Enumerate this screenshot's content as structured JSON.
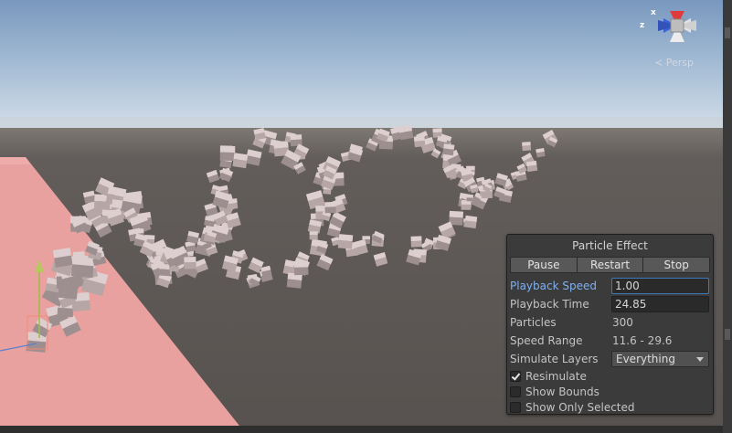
{
  "viewport": {
    "projection_label": "≺ Persp",
    "gizmo_axis_labels": [
      "x",
      "z"
    ]
  },
  "particle_panel": {
    "title": "Particle Effect",
    "buttons": {
      "pause": "Pause",
      "restart": "Restart",
      "stop": "Stop"
    },
    "playback_speed": {
      "label": "Playback Speed",
      "value": "1.00"
    },
    "playback_time": {
      "label": "Playback Time",
      "value": "24.85"
    },
    "particles": {
      "label": "Particles",
      "value": "300"
    },
    "speed_range": {
      "label": "Speed Range",
      "value": "11.6 - 29.6"
    },
    "simulate_layers": {
      "label": "Simulate Layers",
      "value": "Everything"
    },
    "checkboxes": {
      "resimulate": {
        "label": "Resimulate",
        "checked": true
      },
      "show_bounds": {
        "label": "Show Bounds",
        "checked": false
      },
      "show_only_selected": {
        "label": "Show Only Selected",
        "checked": false
      }
    }
  },
  "colors": {
    "sky_top": "#7e9cc0",
    "horizon": "#c7d7e6",
    "ground": "#5a5552",
    "plane": "#e79e9c",
    "particle": "#c9b8b8",
    "accent_label": "#7fb0f0",
    "focus_border": "#3a79bb"
  }
}
